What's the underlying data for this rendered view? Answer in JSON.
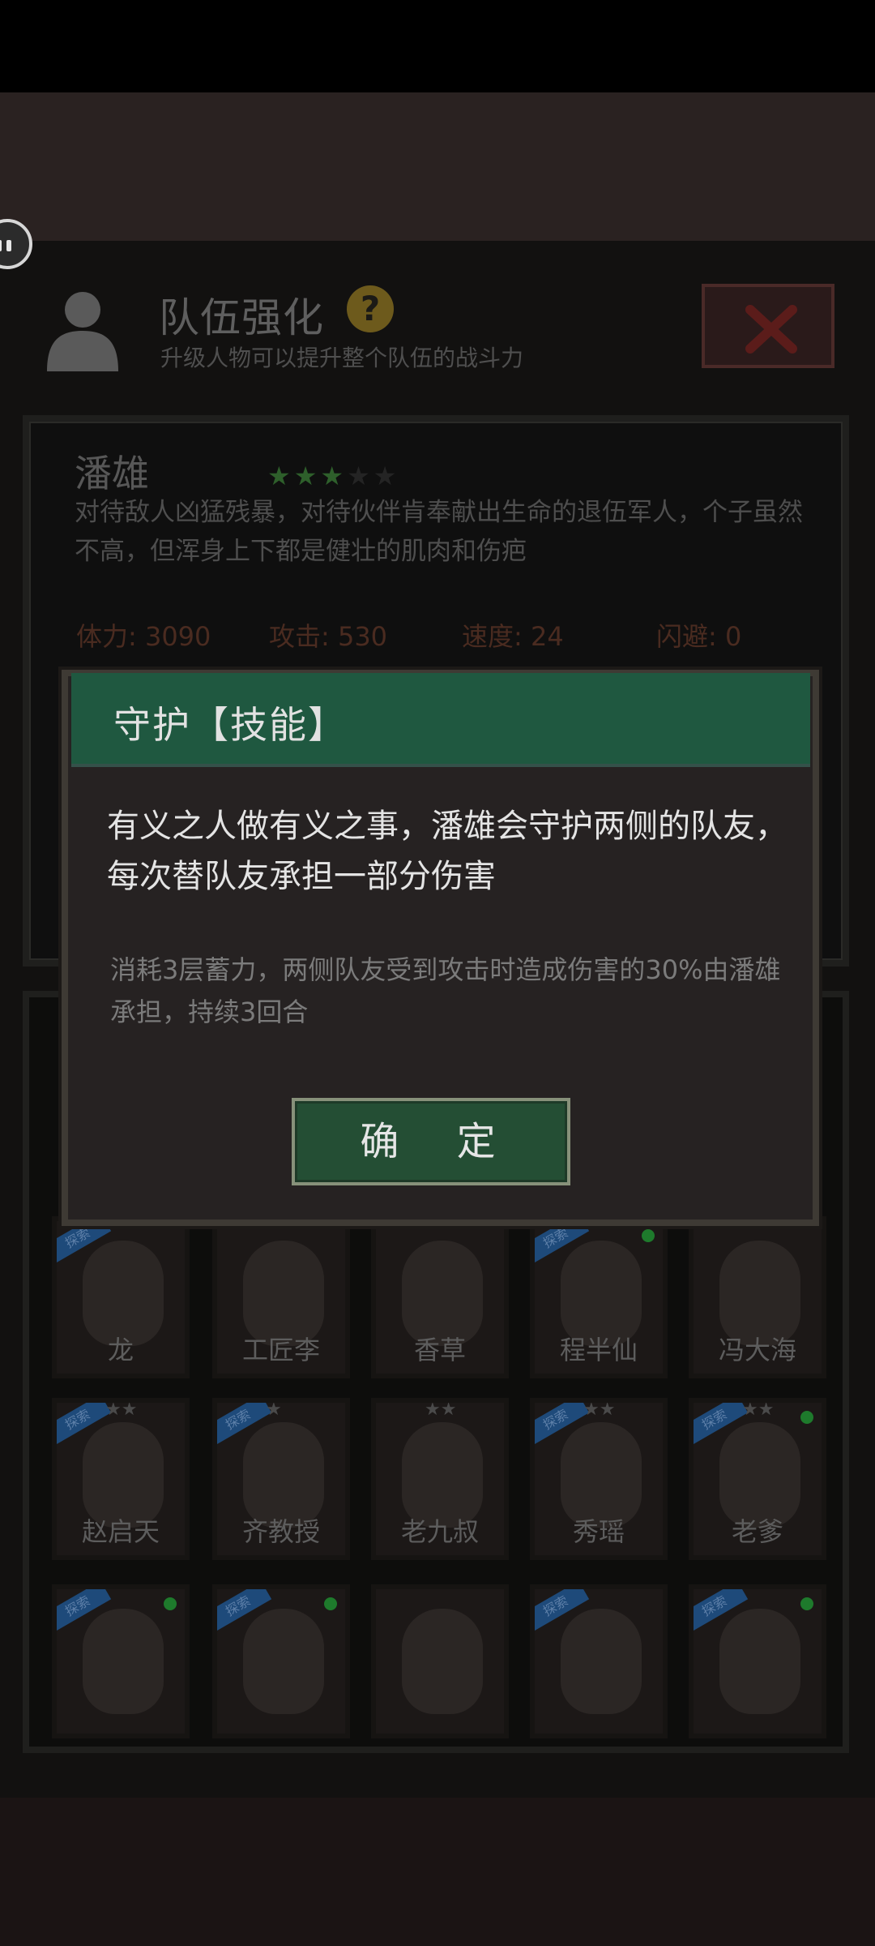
{
  "header": {
    "title": "队伍强化",
    "subtitle": "升级人物可以提升整个队伍的战斗力",
    "help_glyph": "?"
  },
  "character": {
    "name": "潘雄",
    "stars_filled": 3,
    "stars_total": 5,
    "description": "对待敌人凶猛残暴，对待伙伴肯奉献出生命的退伍军人，个子虽然不高，但浑身上下都是健壮的肌肉和伤疤",
    "stats": {
      "hp": "体力: 3090",
      "attack": "攻击: 530",
      "speed": "速度: 24",
      "dodge": "闪避: 0"
    }
  },
  "roster": {
    "row1": [
      "龙",
      "工匠李",
      "香草",
      "程半仙",
      "冯大海"
    ],
    "row2": [
      "赵启天",
      "齐教授",
      "老九叔",
      "秀瑶",
      "老爹"
    ],
    "badge_label": "探索"
  },
  "dialog": {
    "title": "守护【技能】",
    "body": "有义之人做有义之事，潘雄会守护两侧的队友，每次替队友承担一部分伤害",
    "detail": "消耗3层蓄力，两侧队友受到攻击时造成伤害的30%由潘雄承担，持续3回合",
    "confirm_label": "确 定"
  },
  "colors": {
    "dialog_header": "#1f5840",
    "confirm_button": "#244e34",
    "star_active": "#2e5f2b"
  }
}
